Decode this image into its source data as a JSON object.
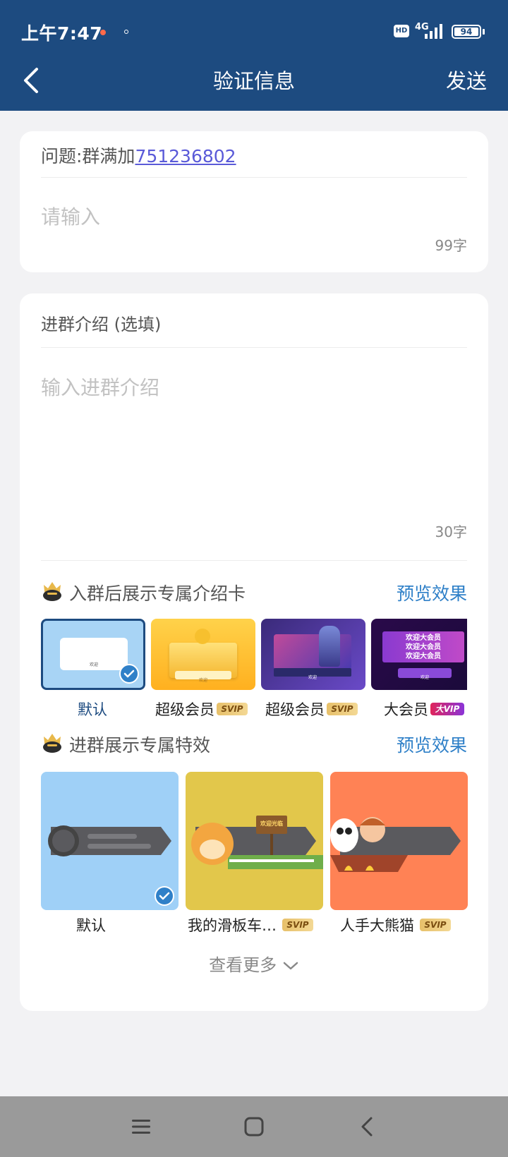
{
  "status_bar": {
    "time": "上午7:47",
    "network": "4G",
    "battery": "94",
    "battery_level": 0.94,
    "hd": "HD"
  },
  "header": {
    "title": "验证信息",
    "send_label": "发送",
    "back_icon": "chevron-left-icon"
  },
  "question_card": {
    "question_prefix": "问题:群满加",
    "question_id": "751236802",
    "answer_placeholder": "请输入",
    "answer_counter": "99字"
  },
  "intro_card": {
    "label": "进群介绍 (选填)",
    "intro_placeholder": "输入进群介绍",
    "intro_counter": "30字",
    "intro_card_section": {
      "title": "入群后展示专属介绍卡",
      "preview_label": "预览效果",
      "cards": [
        {
          "label": "默认",
          "tag": "",
          "selected": true,
          "text": "欢迎"
        },
        {
          "label": "超级会员",
          "tag": "SVIP",
          "selected": false,
          "text": "欢迎"
        },
        {
          "label": "超级会员",
          "tag": "SVIP",
          "selected": false,
          "text": "欢迎"
        },
        {
          "label": "大会员",
          "tag": "大VIP",
          "selected": false,
          "text": "欢迎",
          "banner_lines": [
            "欢迎大会员",
            "欢迎大会员",
            "欢迎大会员"
          ]
        }
      ]
    },
    "effect_section": {
      "title": "进群展示专属特效",
      "preview_label": "预览效果",
      "effects": [
        {
          "label": "默认",
          "tag": "",
          "selected": true
        },
        {
          "label": "我的滑板车…",
          "tag": "SVIP",
          "selected": false,
          "sign": "欢迎光临"
        },
        {
          "label": "人手大熊猫",
          "tag": "SVIP",
          "selected": false
        }
      ]
    },
    "more_label": "查看更多"
  },
  "colors": {
    "header_bg": "#1d4b80",
    "accent": "#2f80c8",
    "link": "#5a5ad8"
  }
}
